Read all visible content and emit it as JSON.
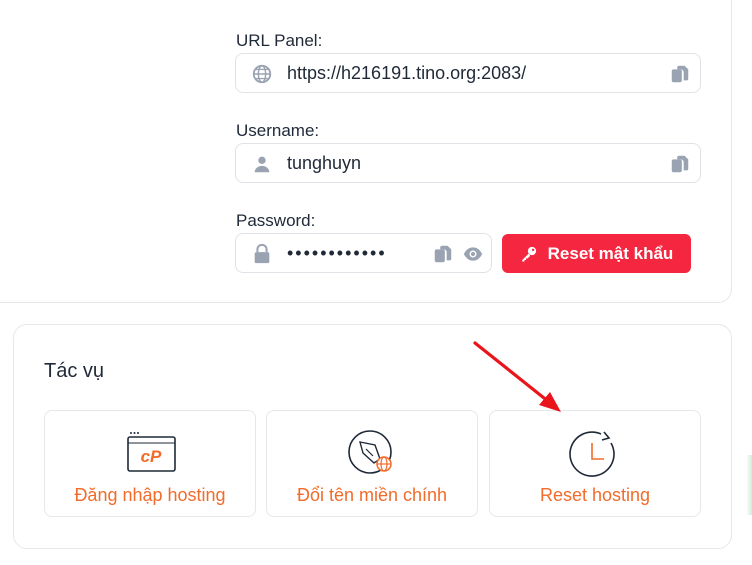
{
  "credentials": {
    "url": {
      "label": "URL Panel:",
      "value": "https://h216191.tino.org:2083/",
      "icon": "globe-icon"
    },
    "username": {
      "label": "Username:",
      "value": "tunghuyn",
      "icon": "user-icon"
    },
    "password": {
      "label": "Password:",
      "value": "••••••••••••",
      "icon": "lock-icon"
    },
    "reset_password_button": {
      "label": "Reset mật khẩu",
      "icon": "key-icon"
    }
  },
  "tasks": {
    "title": "Tác vụ",
    "items": [
      {
        "label": "Đăng nhập hosting",
        "icon": "cpanel-icon"
      },
      {
        "label": "Đổi tên miền chính",
        "icon": "rocket-globe-icon"
      },
      {
        "label": "Reset hosting",
        "icon": "clock-reset-icon"
      }
    ]
  },
  "colors": {
    "accent_orange": "#f26b2a",
    "danger_red": "#f5263f",
    "annotation_arrow": "#e8161b",
    "icon_gray": "#9aa3b2"
  }
}
